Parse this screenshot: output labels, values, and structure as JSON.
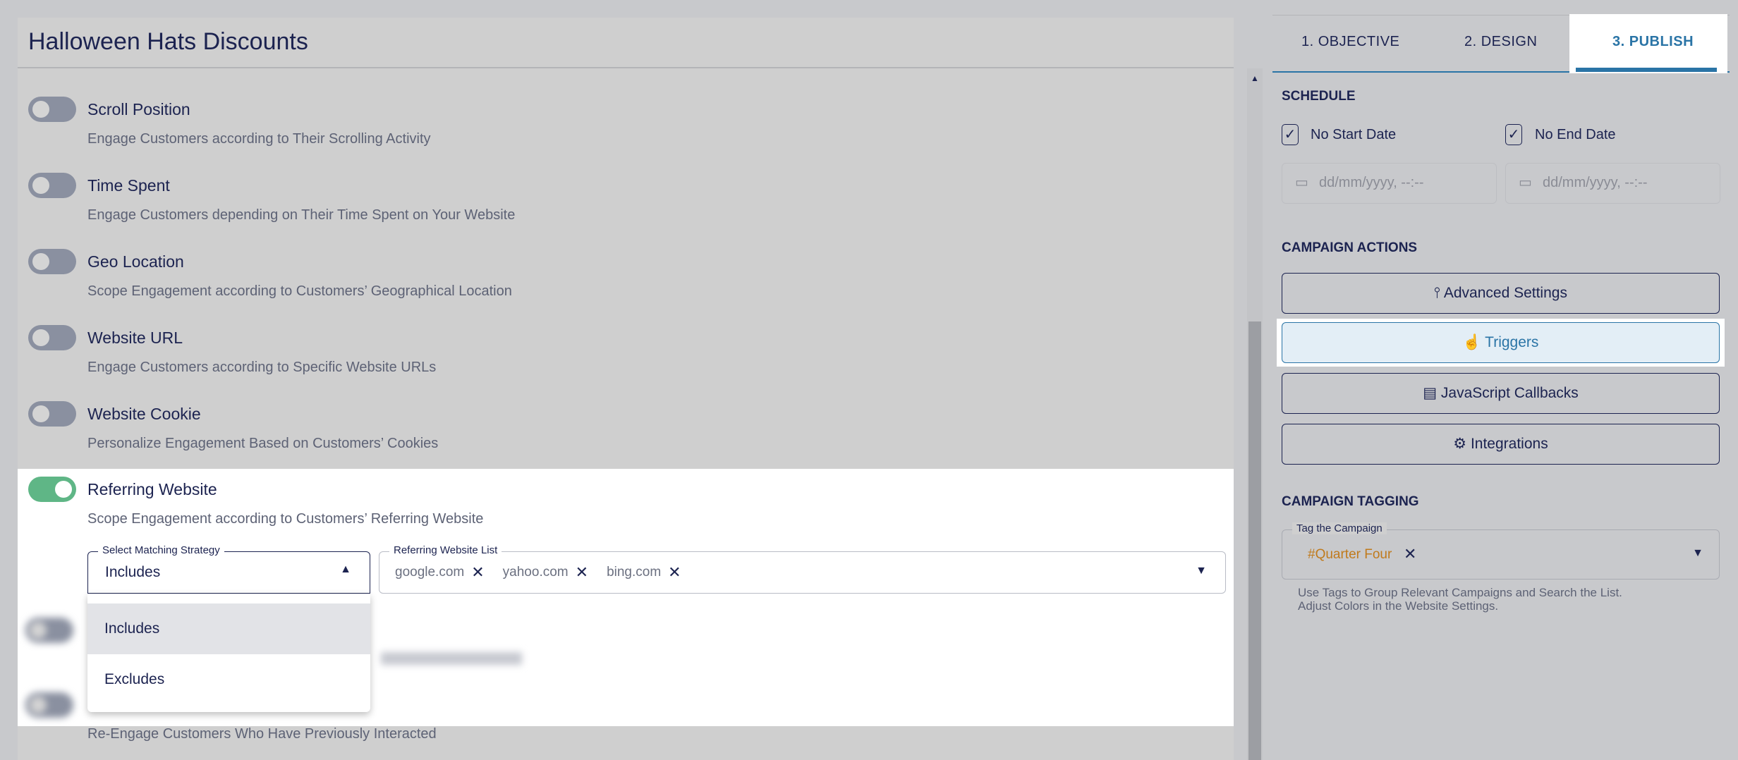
{
  "campaign": {
    "title": "Halloween Hats Discounts"
  },
  "triggers": [
    {
      "title": "Scroll Position",
      "desc": "Engage Customers according to Their Scrolling Activity",
      "enabled": false
    },
    {
      "title": "Time Spent",
      "desc": "Engage Customers depending on Their Time Spent on Your Website",
      "enabled": false
    },
    {
      "title": "Geo Location",
      "desc": "Scope Engagement according to Customers’ Geographical Location",
      "enabled": false
    },
    {
      "title": "Website URL",
      "desc": "Engage Customers according to Specific Website URLs",
      "enabled": false
    },
    {
      "title": "Website Cookie",
      "desc": "Personalize Engagement Based on Customers’ Cookies",
      "enabled": false
    },
    {
      "title": "Referring Website",
      "desc": "Scope Engagement according to Customers’ Referring Website",
      "enabled": true
    }
  ],
  "referring": {
    "strategy_label": "Select Matching Strategy",
    "strategy_value": "Includes",
    "list_label": "Referring Website List",
    "sites": [
      "google.com",
      "yahoo.com",
      "bing.com"
    ],
    "options": [
      "Includes",
      "Excludes"
    ]
  },
  "last_desc": "Re-Engage Customers Who Have Previously Interacted",
  "tabs": [
    "1. OBJECTIVE",
    "2. DESIGN",
    "3. PUBLISH"
  ],
  "active_tab": "3. PUBLISH",
  "schedule": {
    "heading": "SCHEDULE",
    "no_start": "No Start Date",
    "no_end": "No End Date",
    "placeholder": "dd/mm/yyyy, --:--"
  },
  "actions": {
    "heading": "CAMPAIGN ACTIONS",
    "buttons": [
      "Advanced Settings",
      "Triggers",
      "JavaScript Callbacks",
      "Integrations"
    ]
  },
  "tagging": {
    "heading": "CAMPAIGN TAGGING",
    "label": "Tag the Campaign",
    "tag": "#Quarter Four",
    "tag_color": "#c07a1c",
    "help1": "Use Tags to Group Relevant Campaigns and Search the List.",
    "help2": "Adjust Colors in the Website Settings."
  },
  "colors": {
    "accent": "#2a74a6",
    "toggle_on": "#5fb686",
    "navy": "#1c2350"
  }
}
